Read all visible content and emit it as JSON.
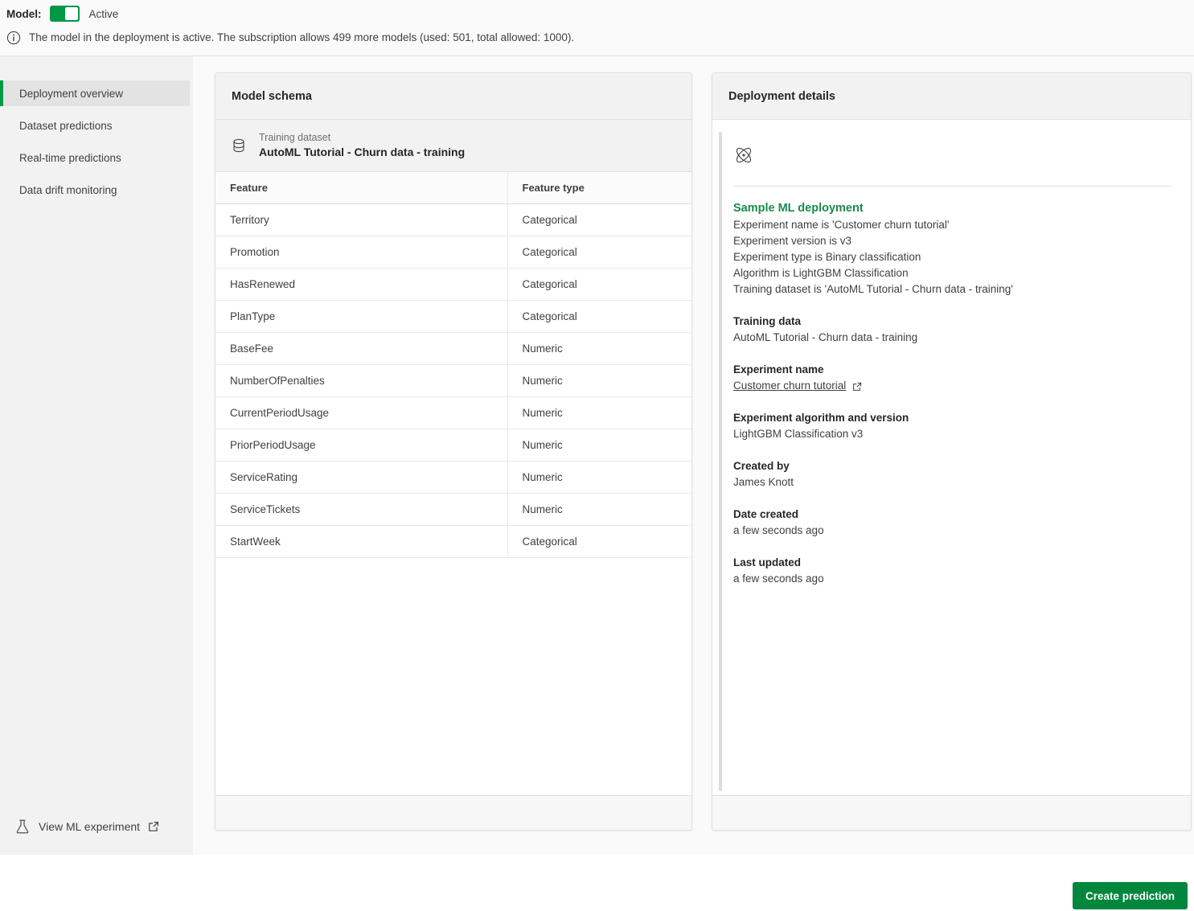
{
  "status_bar": {
    "model_label": "Model:",
    "toggle_state": "Active",
    "toggle_on": true,
    "info_icon": "info-circle-icon",
    "info_text": "The model in the deployment is active. The subscription allows 499 more models (used: 501, total allowed: 1000)."
  },
  "sidebar": {
    "items": [
      {
        "label": "Deployment overview",
        "active": true
      },
      {
        "label": "Dataset predictions",
        "active": false
      },
      {
        "label": "Real-time predictions",
        "active": false
      },
      {
        "label": "Data drift monitoring",
        "active": false
      }
    ],
    "view_experiment": {
      "label": "View ML experiment",
      "icon": "flask-icon",
      "external_icon": "external-link-icon"
    }
  },
  "model_schema": {
    "title": "Model schema",
    "training_dataset": {
      "icon": "database-icon",
      "caption": "Training dataset",
      "value": "AutoML Tutorial - Churn data - training"
    },
    "columns": [
      "Feature",
      "Feature type"
    ],
    "rows": [
      {
        "feature": "Territory",
        "type": "Categorical"
      },
      {
        "feature": "Promotion",
        "type": "Categorical"
      },
      {
        "feature": "HasRenewed",
        "type": "Categorical"
      },
      {
        "feature": "PlanType",
        "type": "Categorical"
      },
      {
        "feature": "BaseFee",
        "type": "Numeric"
      },
      {
        "feature": "NumberOfPenalties",
        "type": "Numeric"
      },
      {
        "feature": "CurrentPeriodUsage",
        "type": "Numeric"
      },
      {
        "feature": "PriorPeriodUsage",
        "type": "Numeric"
      },
      {
        "feature": "ServiceRating",
        "type": "Numeric"
      },
      {
        "feature": "ServiceTickets",
        "type": "Numeric"
      },
      {
        "feature": "StartWeek",
        "type": "Categorical"
      }
    ]
  },
  "deployment_details": {
    "title": "Deployment details",
    "icon": "atom-icon",
    "name": "Sample ML deployment",
    "description_lines": [
      "Experiment name is 'Customer churn tutorial'",
      "Experiment version is v3",
      "Experiment type is Binary classification",
      "Algorithm is LightGBM Classification",
      "Training dataset is 'AutoML Tutorial - Churn data - training'"
    ],
    "fields": [
      {
        "label": "Training data",
        "value": "AutoML Tutorial - Churn data - training",
        "link": false
      },
      {
        "label": "Experiment name",
        "value": "Customer churn tutorial",
        "link": true
      },
      {
        "label": "Experiment algorithm and version",
        "value": "LightGBM Classification v3",
        "link": false
      },
      {
        "label": "Created by",
        "value": "James Knott",
        "link": false
      },
      {
        "label": "Date created",
        "value": "a few seconds ago",
        "link": false
      },
      {
        "label": "Last updated",
        "value": "a few seconds ago",
        "link": false
      }
    ]
  },
  "footer": {
    "primary_button": "Create prediction"
  },
  "colors": {
    "accent_green": "#009845",
    "button_green": "#00873D",
    "heading_green": "#1A8A4F",
    "panel_bg": "#F2F2F2",
    "page_bg": "#FAFAFA",
    "border": "#E0E0E0"
  }
}
